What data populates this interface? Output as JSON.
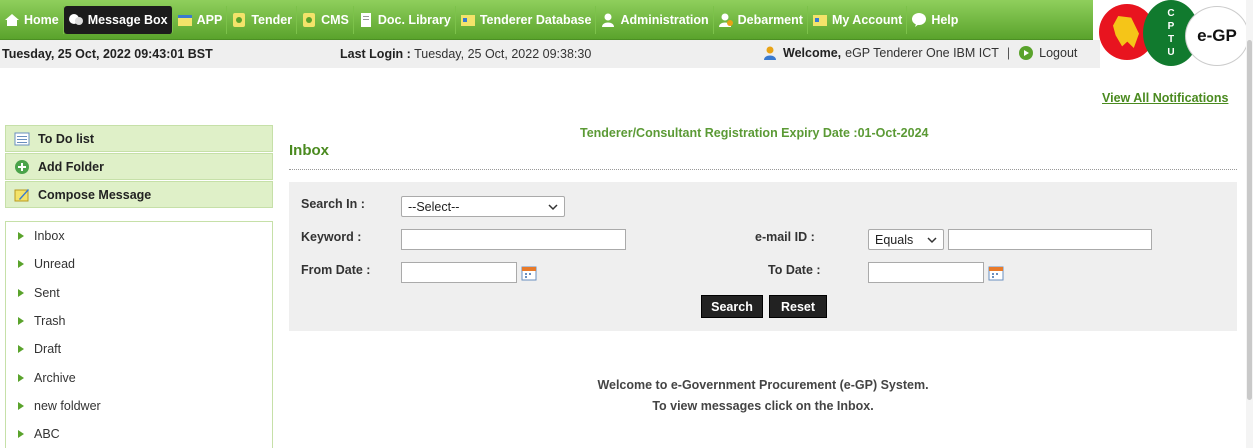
{
  "nav": [
    {
      "label": "Home",
      "icon": "home-icon"
    },
    {
      "label": "Message Box",
      "icon": "message-icon",
      "active": true
    },
    {
      "label": "APP",
      "icon": "app-icon"
    },
    {
      "label": "Tender",
      "icon": "tender-icon"
    },
    {
      "label": "CMS",
      "icon": "cms-icon"
    },
    {
      "label": "Doc. Library",
      "icon": "document-icon"
    },
    {
      "label": "Tenderer Database",
      "icon": "database-icon"
    },
    {
      "label": "Administration",
      "icon": "user-icon"
    },
    {
      "label": "Debarment",
      "icon": "debarment-icon"
    },
    {
      "label": "My Account",
      "icon": "account-icon"
    },
    {
      "label": "Help",
      "icon": "help-icon"
    }
  ],
  "logo": {
    "cptu_letters": [
      "C",
      "P",
      "T",
      "U"
    ],
    "egp": "e-GP"
  },
  "info": {
    "datetime": "Tuesday, 25 Oct, 2022 09:43:01 BST",
    "last_login_label": "Last Login :",
    "last_login_value": "Tuesday, 25 Oct, 2022 09:38:30",
    "welcome_label": "Welcome,",
    "welcome_user": "eGP Tenderer One IBM ICT",
    "separator": "|",
    "logout": "Logout"
  },
  "view_all": "View All Notifications",
  "side_actions": [
    {
      "label": "To Do list",
      "icon": "todo-list-icon"
    },
    {
      "label": "Add Folder",
      "icon": "add-folder-icon"
    },
    {
      "label": "Compose Message",
      "icon": "compose-icon"
    }
  ],
  "folders": [
    "Inbox",
    "Unread",
    "Sent",
    "Trash",
    "Draft",
    "Archive",
    "new foldwer",
    "ABC"
  ],
  "main": {
    "expiry": "Tenderer/Consultant Registration Expiry Date :01-Oct-2024",
    "title": "Inbox",
    "search": {
      "search_in_label": "Search In :",
      "search_in_value": "--Select--",
      "keyword_label": "Keyword :",
      "keyword_value": "",
      "email_label": "e-mail ID :",
      "email_op": "Equals",
      "email_value": "",
      "from_label": "From Date :",
      "from_value": "",
      "to_label": "To Date :",
      "to_value": "",
      "search_btn": "Search",
      "reset_btn": "Reset"
    },
    "welcome_line1": "Welcome to e-Government Procurement (e-GP) System.",
    "welcome_line2": "To view messages click on the Inbox."
  },
  "colors": {
    "nav_green": "#5aa32c",
    "accent_green": "#4a8a1f",
    "panel_gray": "#efefef",
    "side_green": "#dff0c8"
  }
}
